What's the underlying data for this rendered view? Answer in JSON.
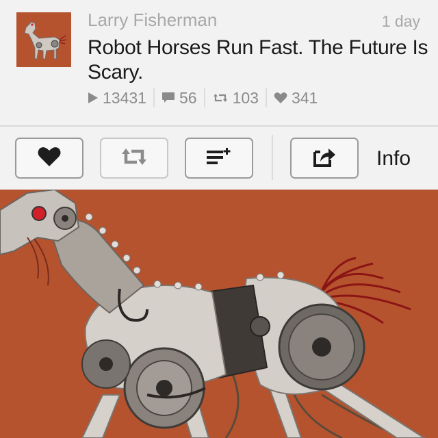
{
  "post": {
    "author": "Larry Fisherman",
    "time": "1 day",
    "title": "Robot Horses Run Fast. The Future Is Scary.",
    "stats": {
      "plays": "13431",
      "comments": "56",
      "revines": "103",
      "likes": "341"
    }
  },
  "toolbar": {
    "info_label": "Info"
  },
  "icons": {
    "play": "play-icon",
    "comment": "comment-icon",
    "revine": "revine-icon",
    "like": "heart-icon",
    "add_to_list": "playlist-add-icon",
    "share": "share-icon"
  },
  "colors": {
    "accent_bg": "#b5532f",
    "text_muted": "#a8a8a8",
    "text_main": "#1a1a1a"
  }
}
